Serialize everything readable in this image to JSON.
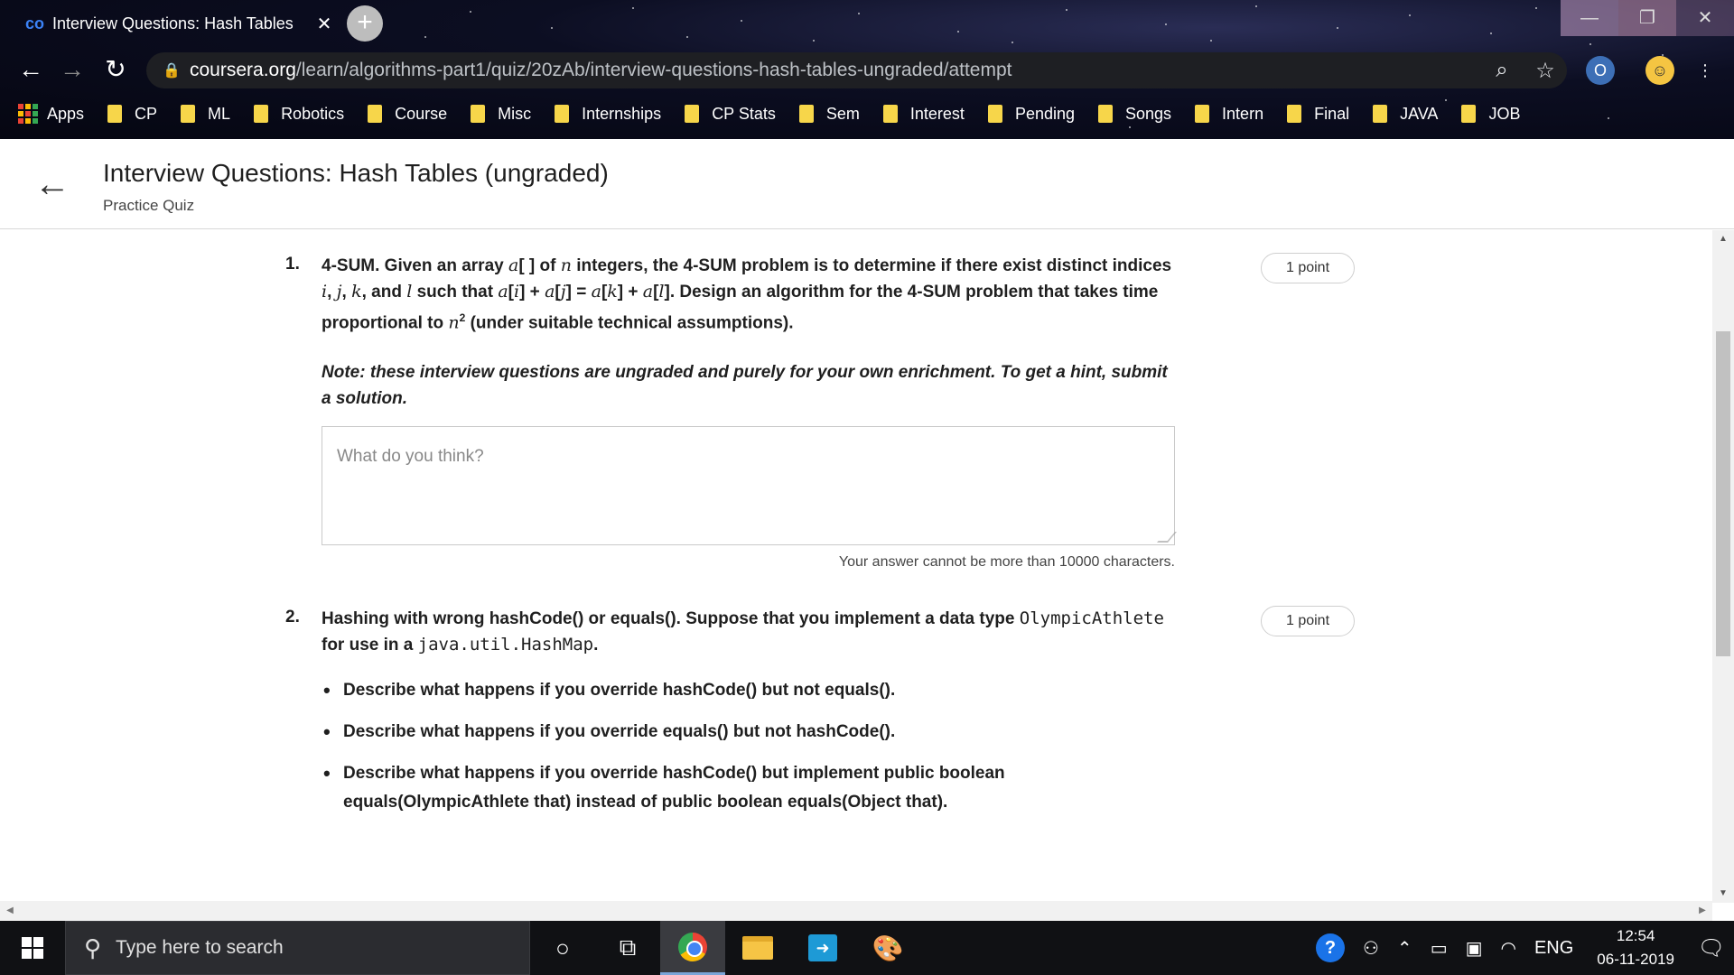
{
  "browser": {
    "tab_title": "Interview Questions: Hash Tables",
    "tab_close": "✕",
    "new_tab": "+",
    "url_host": "coursera.org",
    "url_path": "/learn/algorithms-part1/quiz/20zAb/interview-questions-hash-tables-ungraded/attempt",
    "bookmarks": [
      "Apps",
      "CP",
      "ML",
      "Robotics",
      "Course",
      "Misc",
      "Internships",
      "CP Stats",
      "Sem",
      "Interest",
      "Pending",
      "Songs",
      "Intern",
      "Final",
      "JAVA",
      "JOB"
    ]
  },
  "header": {
    "title": "Interview Questions: Hash Tables (ungraded)",
    "subtitle": "Practice Quiz"
  },
  "questions": [
    {
      "number": "1.",
      "points": "1 point",
      "title": "4-SUM.",
      "answer_placeholder": "What do you think?",
      "limit_text": "Your answer cannot be more than 10000 characters.",
      "note": "Note: these interview questions are ungraded and purely for your own enrichment. To get a hint, submit a solution."
    },
    {
      "number": "2.",
      "points": "1 point",
      "title": "Hashing with wrong hashCode() or equals().",
      "bullets": [
        "Describe what happens if you override hashCode() but not equals().",
        "Describe what happens if you override equals() but not hashCode().",
        "Describe what happens if you override hashCode() but implement public boolean equals(OlympicAthlete that) instead of public boolean equals(Object that)."
      ]
    }
  ],
  "taskbar": {
    "search_placeholder": "Type here to search",
    "lang": "ENG",
    "time": "12:54",
    "date": "06-11-2019"
  }
}
